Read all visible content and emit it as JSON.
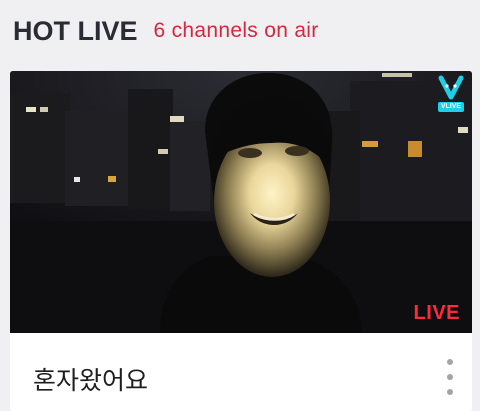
{
  "header": {
    "title": "HOT LIVE",
    "subtitle": "6 channels on air"
  },
  "card": {
    "title": "혼자왔어요",
    "live_badge": "LIVE",
    "logo_text": "VLIVE",
    "logo_icon": "vlive-logo-icon",
    "more_icon": "more-vertical-icon"
  },
  "colors": {
    "accent_red": "#d7263d",
    "live_red": "#ff2b3d",
    "vlive_cyan": "#1ecfe6",
    "title_dark": "#2b2b35",
    "background": "#f0f0f2"
  }
}
